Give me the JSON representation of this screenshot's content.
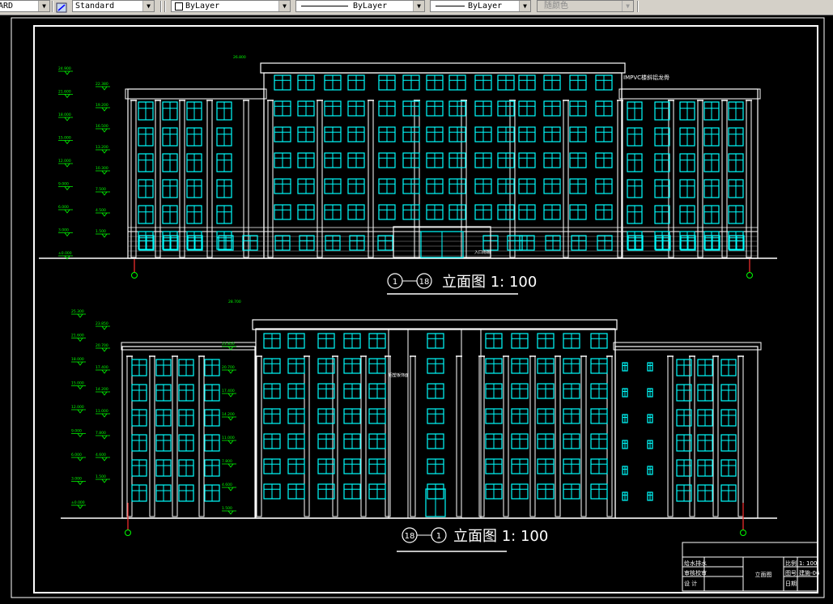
{
  "toolbar": {
    "text_style_left": "ARD",
    "dim_style": "Standard",
    "layer_color": "ByLayer",
    "linetype": "ByLayer",
    "lineweight": "ByLayer",
    "plot_style": "随颜色"
  },
  "drawing": {
    "upper": {
      "title_start": "1",
      "title_end": "18",
      "title_text": "立面图 1: 100",
      "roof_label": "IMPVC楼斜铝龙骨",
      "levels": [
        "24.900",
        "21.600",
        "18.000",
        "15.000",
        "12.000",
        "9.000",
        "6.000",
        "3.000",
        "±0.000"
      ],
      "right_levels": [
        "22.380",
        "19.200",
        "16.500",
        "13.200",
        "10.300",
        "7.500",
        "4.500",
        "1.500"
      ],
      "top_mark": "26.800",
      "entry_label": "入口雨棚"
    },
    "lower": {
      "title_start": "18",
      "title_end": "1",
      "title_text": "立面图 1: 100",
      "tower_label": "铝塑板饰面",
      "levels": [
        "25.300",
        "21.600",
        "18.000",
        "15.000",
        "12.000",
        "9.000",
        "6.000",
        "3.000",
        "±0.000"
      ],
      "right_levels": [
        "23.850",
        "20.700",
        "17.400",
        "14.200",
        "11.000",
        "7.800",
        "4.600",
        "1.500"
      ],
      "top_mark": "28.700"
    },
    "axis_labels": {
      "upper_left": "1",
      "upper_right": "18",
      "lower_left": "18",
      "lower_right": "1"
    }
  },
  "title_block": {
    "row1_left": "给水排水",
    "row2_left": "审核校审",
    "row3_left": "设 计",
    "center": "立面图",
    "scale_label": "比例",
    "scale_value": "1: 100",
    "drawing_no_label": "图号",
    "drawing_no_value": "建施-06",
    "date_label": "日期",
    "date_value": ""
  },
  "colors": {
    "background": "#000000",
    "lines": "#ffffff",
    "windows": "#00ffff",
    "levels": "#00ff00",
    "axis_marker": "#00ff00",
    "section_red": "#ff3030"
  }
}
